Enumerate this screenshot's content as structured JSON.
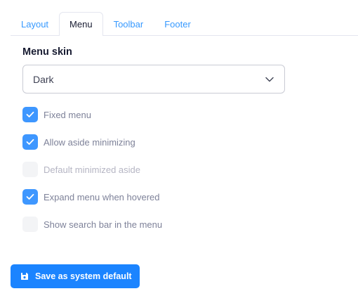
{
  "tabs": [
    {
      "label": "Layout",
      "active": false
    },
    {
      "label": "Menu",
      "active": true
    },
    {
      "label": "Toolbar",
      "active": false
    },
    {
      "label": "Footer",
      "active": false
    }
  ],
  "menu_skin": {
    "title": "Menu skin",
    "selected": "Dark"
  },
  "options": [
    {
      "label": "Fixed menu",
      "checked": true,
      "disabled": false
    },
    {
      "label": "Allow aside minimizing",
      "checked": true,
      "disabled": false
    },
    {
      "label": "Default minimized aside",
      "checked": false,
      "disabled": true
    },
    {
      "label": "Expand menu when hovered",
      "checked": true,
      "disabled": false
    },
    {
      "label": "Show search bar in the menu",
      "checked": false,
      "disabled": false
    }
  ],
  "save_button": {
    "label": "Save as system default",
    "icon": "save-icon"
  },
  "colors": {
    "accent": "#3e97ff",
    "button": "#1b84ff",
    "tab_link": "#3699ff"
  }
}
